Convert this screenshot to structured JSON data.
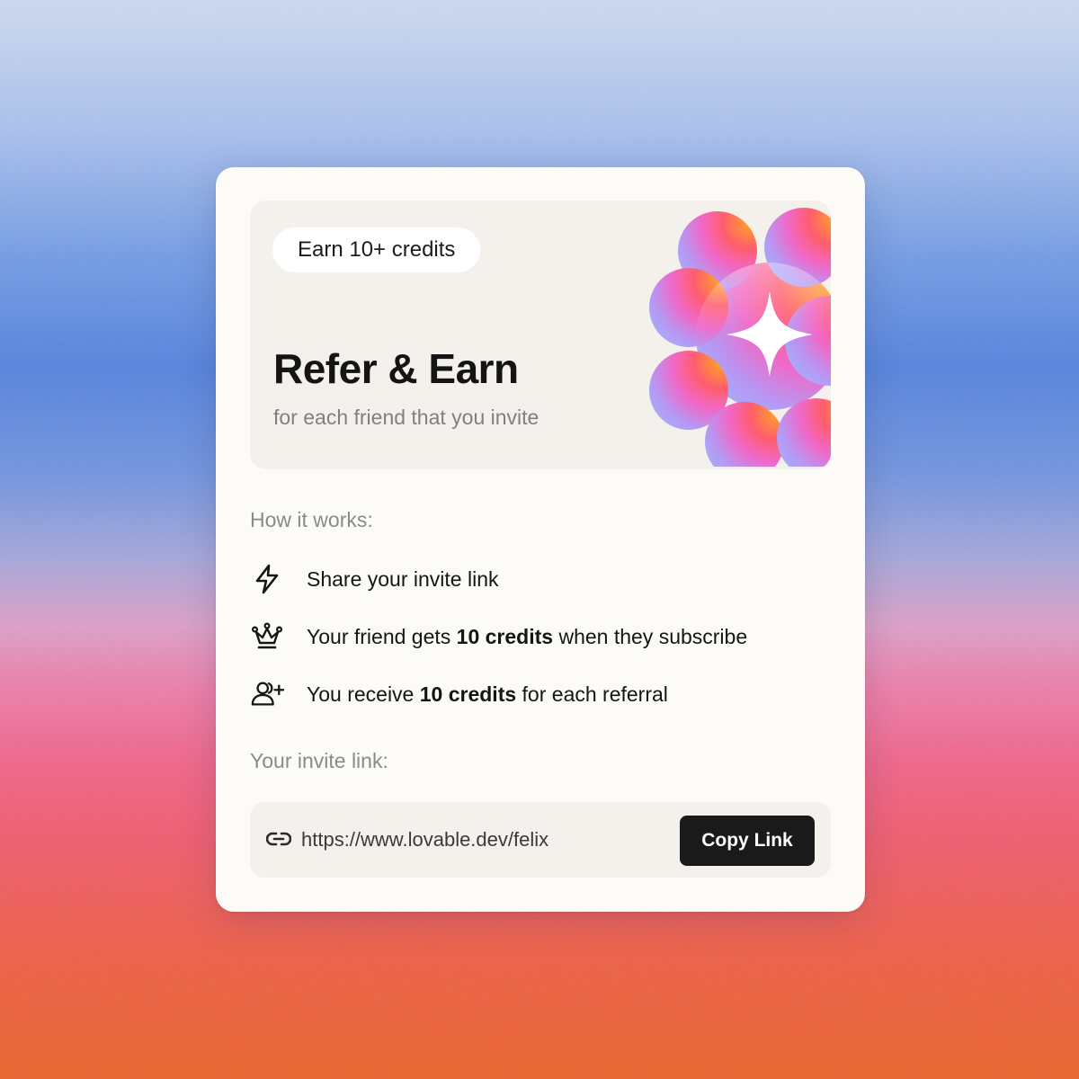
{
  "background": {
    "gradient_colors": [
      "#cfdcf4",
      "#4f80e0",
      "#f07aa8",
      "#f4576a",
      "#ef5f24"
    ]
  },
  "hero": {
    "badge": "Earn 10+ credits",
    "title": "Refer & Earn",
    "subtitle": "for each friend that you invite",
    "illustration_icon": "flower-sparkle-icon"
  },
  "how_it_works": {
    "label": "How it works:",
    "steps": [
      {
        "icon": "lightning-icon",
        "pre": "Share your invite link",
        "bold": "",
        "post": ""
      },
      {
        "icon": "crown-icon",
        "pre": "Your friend gets ",
        "bold": "10 credits",
        "post": " when they subscribe"
      },
      {
        "icon": "user-plus-icon",
        "pre": "You receive ",
        "bold": "10 credits",
        "post": " for each referral"
      }
    ]
  },
  "invite": {
    "label": "Your invite link:",
    "url": "https://www.lovable.dev/felix",
    "link_icon": "link-icon",
    "copy_button": "Copy Link"
  },
  "colors": {
    "card": "#fcfbf8",
    "panel": "#f4f1ec",
    "button": "#1a1a1a",
    "text": "#151515",
    "muted": "#8a8a8a"
  }
}
